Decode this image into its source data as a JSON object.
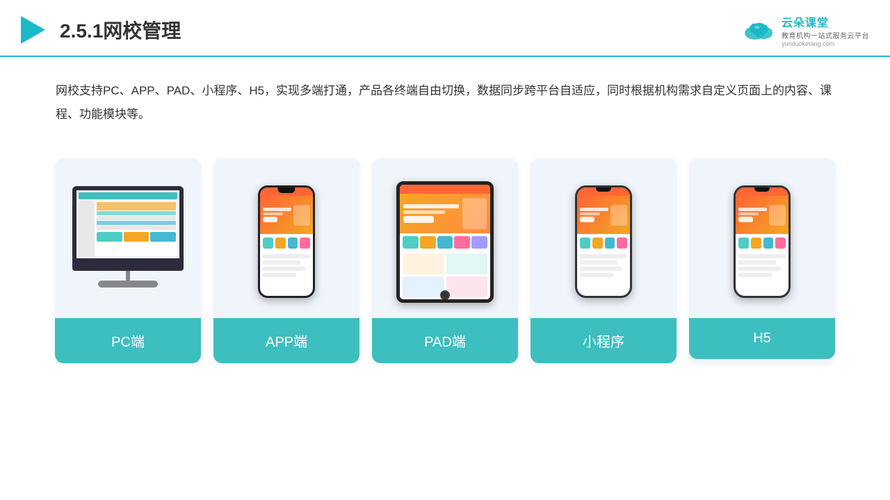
{
  "header": {
    "title": "2.5.1网校管理",
    "brand": {
      "name": "云朵课堂",
      "url": "yunduoketang.com",
      "tagline": "教育机构一站式服务云平台"
    }
  },
  "description": {
    "text": "网校支持PC、APP、PAD、小程序、H5，实现多端打通，产品各终端自由切换，数据同步跨平台自适应，同时根据机构需求自定义页面上的内容、课程、功能模块等。"
  },
  "cards": [
    {
      "id": "pc",
      "label": "PC端"
    },
    {
      "id": "app",
      "label": "APP端"
    },
    {
      "id": "pad",
      "label": "PAD端"
    },
    {
      "id": "miniprogram",
      "label": "小程序"
    },
    {
      "id": "h5",
      "label": "H5"
    }
  ],
  "colors": {
    "accent": "#3dbfbf",
    "border": "#1db8c8",
    "card_bg": "#f0f4fb"
  }
}
